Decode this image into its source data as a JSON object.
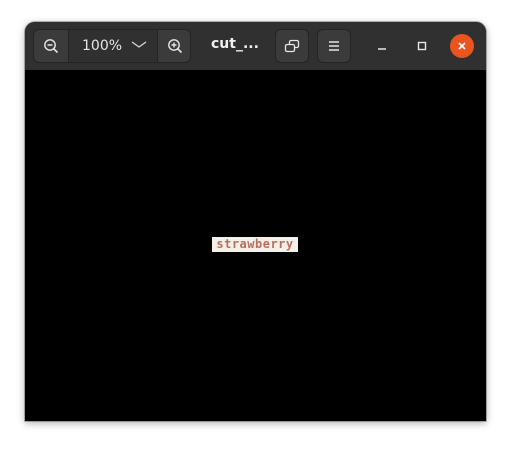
{
  "window": {
    "title": "cut_..."
  },
  "toolbar": {
    "zoom_level": "100%"
  },
  "icons": {
    "zoom_out": "zoom-out-icon",
    "zoom_dropdown": "chevron-down-icon",
    "zoom_in": "zoom-in-icon",
    "fullscreen": "fullscreen-icon",
    "menu": "hamburger-menu-icon",
    "minimize": "minimize-icon",
    "maximize": "maximize-icon",
    "close": "close-icon"
  },
  "colors": {
    "headerbar": "#303030",
    "canvas": "#000000",
    "close_button": "#e95420",
    "image_background": "#f4efe9",
    "image_text": "#b8705e"
  },
  "image": {
    "text": "strawberry"
  }
}
